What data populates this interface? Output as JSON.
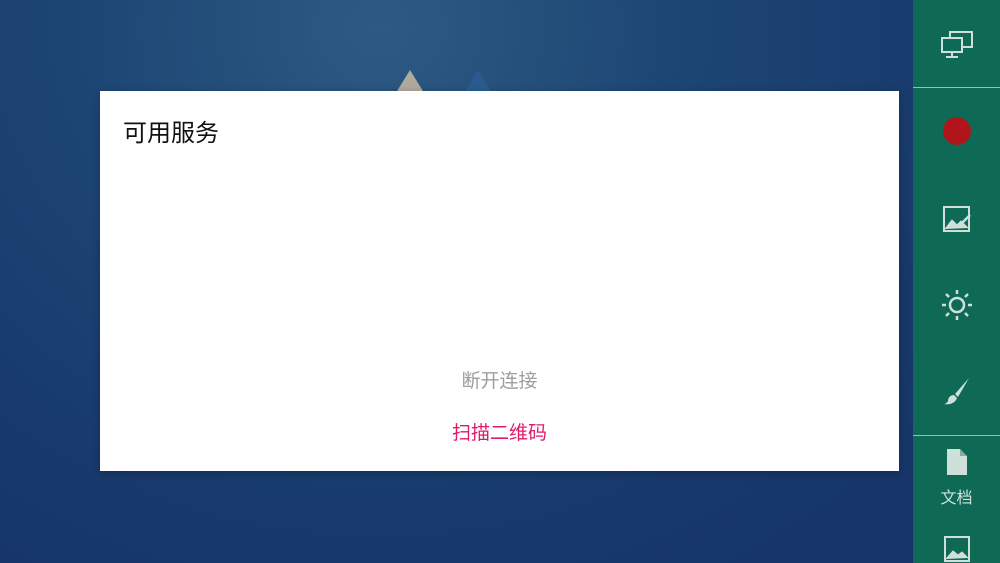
{
  "dialog": {
    "title": "可用服务",
    "disconnect_label": "断开连接",
    "scan_label": "扫描二维码"
  },
  "toolbar": {
    "items": [
      {
        "icon": "screen-mirror-icon"
      },
      {
        "icon": "record-icon"
      },
      {
        "icon": "image-edit-icon"
      },
      {
        "icon": "brightness-icon"
      },
      {
        "icon": "brush-icon"
      },
      {
        "icon": "document-icon",
        "label": "文档"
      },
      {
        "icon": "picture-icon"
      }
    ]
  },
  "colors": {
    "toolbar_bg": "#0e6a54",
    "record": "#b0151c",
    "scan_accent": "#e0186c",
    "disabled_text": "#9e9e9e"
  }
}
